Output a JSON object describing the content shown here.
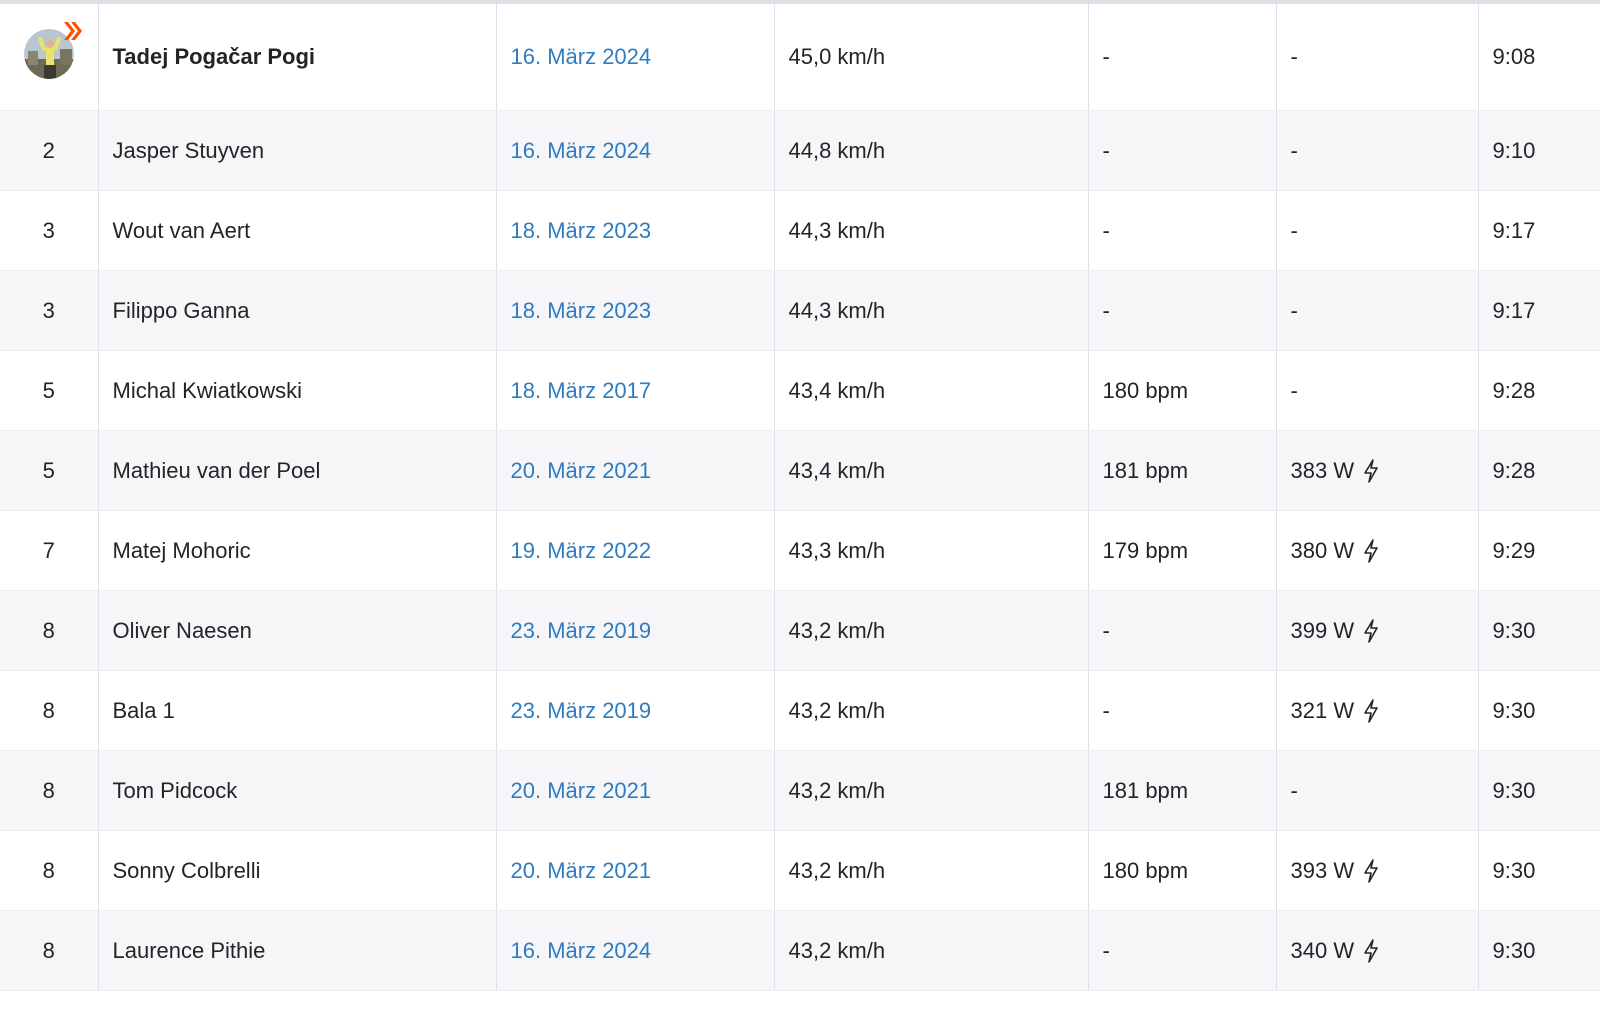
{
  "leaderboard": {
    "rows": [
      {
        "rank": "",
        "name": "Tadej Pogačar Pogi",
        "date": "16. März 2024",
        "speed": "45,0 km/h",
        "heart_rate": "-",
        "power": "-",
        "power_estimated": false,
        "time": "9:08",
        "is_self": true
      },
      {
        "rank": "2",
        "name": "Jasper Stuyven",
        "date": "16. März 2024",
        "speed": "44,8 km/h",
        "heart_rate": "-",
        "power": "-",
        "power_estimated": false,
        "time": "9:10"
      },
      {
        "rank": "3",
        "name": "Wout van Aert",
        "date": "18. März 2023",
        "speed": "44,3 km/h",
        "heart_rate": "-",
        "power": "-",
        "power_estimated": false,
        "time": "9:17"
      },
      {
        "rank": "3",
        "name": "Filippo Ganna",
        "date": "18. März 2023",
        "speed": "44,3 km/h",
        "heart_rate": "-",
        "power": "-",
        "power_estimated": false,
        "time": "9:17"
      },
      {
        "rank": "5",
        "name": "Michal Kwiatkowski",
        "date": "18. März 2017",
        "speed": "43,4 km/h",
        "heart_rate": "180 bpm",
        "power": "-",
        "power_estimated": false,
        "time": "9:28"
      },
      {
        "rank": "5",
        "name": "Mathieu van der Poel",
        "date": "20. März 2021",
        "speed": "43,4 km/h",
        "heart_rate": "181 bpm",
        "power": "383 W",
        "power_estimated": true,
        "time": "9:28"
      },
      {
        "rank": "7",
        "name": "Matej Mohoric",
        "date": "19. März 2022",
        "speed": "43,3 km/h",
        "heart_rate": "179 bpm",
        "power": "380 W",
        "power_estimated": true,
        "time": "9:29"
      },
      {
        "rank": "8",
        "name": "Oliver Naesen",
        "date": "23. März 2019",
        "speed": "43,2 km/h",
        "heart_rate": "-",
        "power": "399 W",
        "power_estimated": true,
        "time": "9:30"
      },
      {
        "rank": "8",
        "name": "Bala 1",
        "date": "23. März 2019",
        "speed": "43,2 km/h",
        "heart_rate": "-",
        "power": "321 W",
        "power_estimated": true,
        "time": "9:30"
      },
      {
        "rank": "8",
        "name": "Tom Pidcock",
        "date": "20. März 2021",
        "speed": "43,2 km/h",
        "heart_rate": "181 bpm",
        "power": "-",
        "power_estimated": false,
        "time": "9:30"
      },
      {
        "rank": "8",
        "name": "Sonny Colbrelli",
        "date": "20. März 2021",
        "speed": "43,2 km/h",
        "heart_rate": "180 bpm",
        "power": "393 W",
        "power_estimated": true,
        "time": "9:30"
      },
      {
        "rank": "8",
        "name": "Laurence Pithie",
        "date": "16. März 2024",
        "speed": "43,2 km/h",
        "heart_rate": "-",
        "power": "340 W",
        "power_estimated": true,
        "time": "9:30"
      }
    ],
    "first_row_icon": "crown-kom-icon",
    "colors": {
      "link": "#2f7cbf",
      "accent": "#fc5200",
      "row_alt": "#f6f6f9"
    }
  }
}
